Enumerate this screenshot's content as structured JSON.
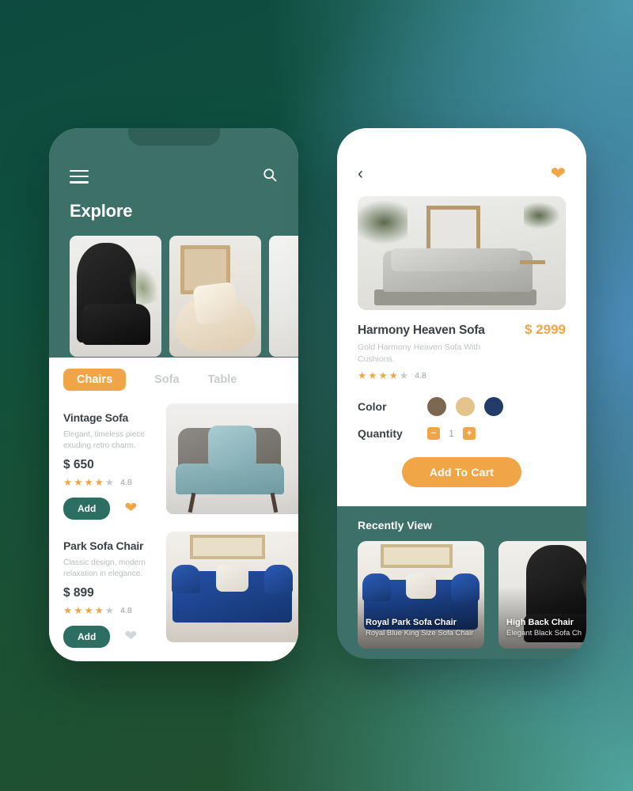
{
  "background": {
    "gradient_start": "#0e4a3f",
    "gradient_mid_teal": "#4da0ac",
    "gradient_blue": "#4f8fc0",
    "gradient_end": "#234f2e"
  },
  "theme": {
    "green": "#3d7068",
    "green_button": "#2d6e63",
    "orange": "#f0a647",
    "dark_text": "#3a4246",
    "muted_text": "#c0c4c7"
  },
  "explore_screen": {
    "menu_icon": "hamburger-icon",
    "search_icon": "search-icon",
    "title": "Explore",
    "carousel": [
      {
        "alt": "Black tufted wing back chair"
      },
      {
        "alt": "Beige round lounge chair with cushion"
      },
      {
        "alt": "Light sofa partial view"
      }
    ],
    "tabs": [
      {
        "label": "Chairs",
        "active": true
      },
      {
        "label": "Sofa",
        "active": false
      },
      {
        "label": "Table",
        "active": false
      }
    ],
    "products": [
      {
        "name": "Vintage Sofa",
        "description": "Elegant, timeless piece exuding retro charm.",
        "price": "$ 650",
        "rating_value": "4.8",
        "stars_filled": 4,
        "stars_total": 5,
        "add_label": "Add",
        "favorited": true,
        "image_alt": "Teal patterned armchair with cushion"
      },
      {
        "name": "Park Sofa Chair",
        "description": "Classic design, modern relaxation in elegance.",
        "price": "$ 899",
        "rating_value": "4.8",
        "stars_filled": 4,
        "stars_total": 5,
        "add_label": "Add",
        "favorited": false,
        "image_alt": "Royal blue chesterfield armchair"
      }
    ]
  },
  "detail_screen": {
    "back_icon": "chevron-left-icon",
    "favorite_icon": "heart-icon",
    "favorited": true,
    "hero_alt": "Grey Harmony Heaven sofa in bright living room",
    "product": {
      "title": "Harmony Heaven Sofa",
      "price": "$ 2999",
      "description": "Gold Harmony Heaven Sofa With Cushions.",
      "rating_value": "4.8",
      "stars_filled": 4,
      "stars_total": 5
    },
    "color_label": "Color",
    "colors": [
      {
        "name": "brown",
        "hex": "#7c6850",
        "selected": false
      },
      {
        "name": "tan",
        "hex": "#e4c38d",
        "selected": false
      },
      {
        "name": "navy",
        "hex": "#233b69",
        "selected": false
      }
    ],
    "quantity_label": "Quantity",
    "quantity_value": "1",
    "decrement_label": "−",
    "increment_label": "+",
    "add_to_cart_label": "Add To Cart",
    "recently_view": {
      "title": "Recently View",
      "items": [
        {
          "title": "Royal Park Sofa Chair",
          "subtitle": "Royal Blue King Size Sofa Chair",
          "image_alt": "Royal blue chesterfield chair"
        },
        {
          "title": "High Back Chair",
          "subtitle": "Elegant Black Sofa Ch",
          "image_alt": "Black high back wing chair"
        }
      ]
    }
  }
}
